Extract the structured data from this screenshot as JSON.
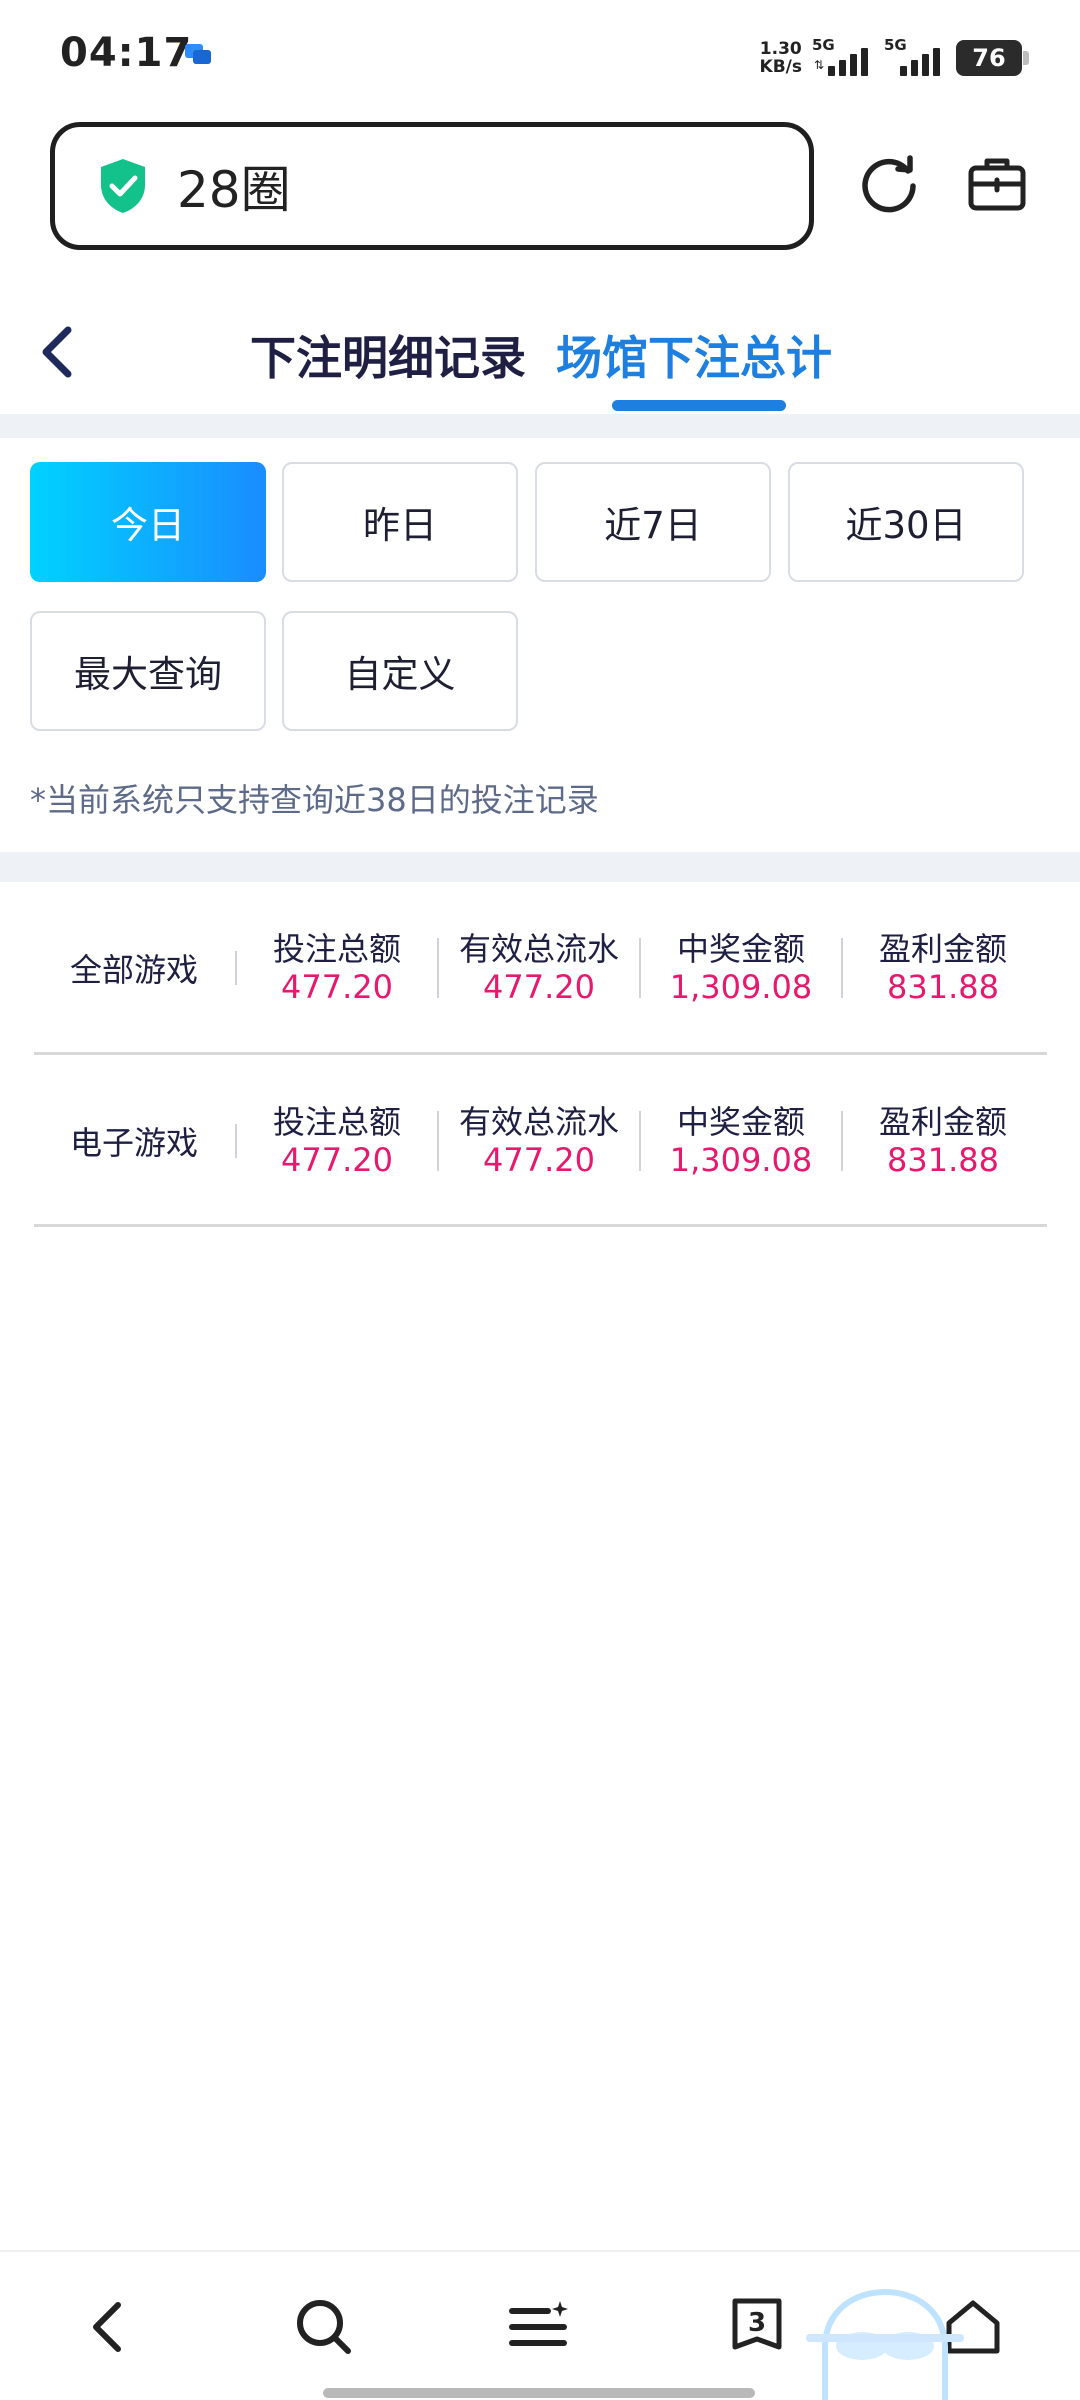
{
  "status_bar": {
    "time": "04:17",
    "net_speed_value": "1.30",
    "net_speed_unit": "KB/s",
    "sim1_label": "5G",
    "sim2_label": "5G",
    "battery": "76"
  },
  "browser": {
    "address_text": "28圈",
    "icons": [
      "shield-check-icon",
      "refresh-icon",
      "briefcase-icon"
    ]
  },
  "header": {
    "tabs": [
      {
        "label": "下注明细记录",
        "active": false
      },
      {
        "label": "场馆下注总计",
        "active": true
      }
    ]
  },
  "filters": {
    "options": [
      "今日",
      "昨日",
      "近7日",
      "近30日",
      "最大查询",
      "自定义"
    ],
    "selected": "今日"
  },
  "note": "*当前系统只支持查询近38日的投注记录",
  "summary": {
    "rows": [
      {
        "label": "全部游戏",
        "cells": [
          {
            "key": "投注总额",
            "value": "477.20"
          },
          {
            "key": "有效总流水",
            "value": "477.20"
          },
          {
            "key": "中奖金额",
            "value": "1,309.08"
          },
          {
            "key": "盈利金额",
            "value": "831.88"
          }
        ]
      },
      {
        "label": "电子游戏",
        "cells": [
          {
            "key": "投注总额",
            "value": "477.20"
          },
          {
            "key": "有效总流水",
            "value": "477.20"
          },
          {
            "key": "中奖金额",
            "value": "1,309.08"
          },
          {
            "key": "盈利金额",
            "value": "831.88"
          }
        ]
      }
    ]
  },
  "bottom_nav": {
    "tab_count": "3",
    "icons": [
      "back-icon",
      "search-icon",
      "menu-icon",
      "tabs-icon",
      "home-icon"
    ]
  },
  "colors": {
    "accent_blue": "#1d7fe0",
    "value_pink": "#e8186e",
    "active_gradient_start": "#00d2ff",
    "active_gradient_end": "#1a8cff"
  }
}
